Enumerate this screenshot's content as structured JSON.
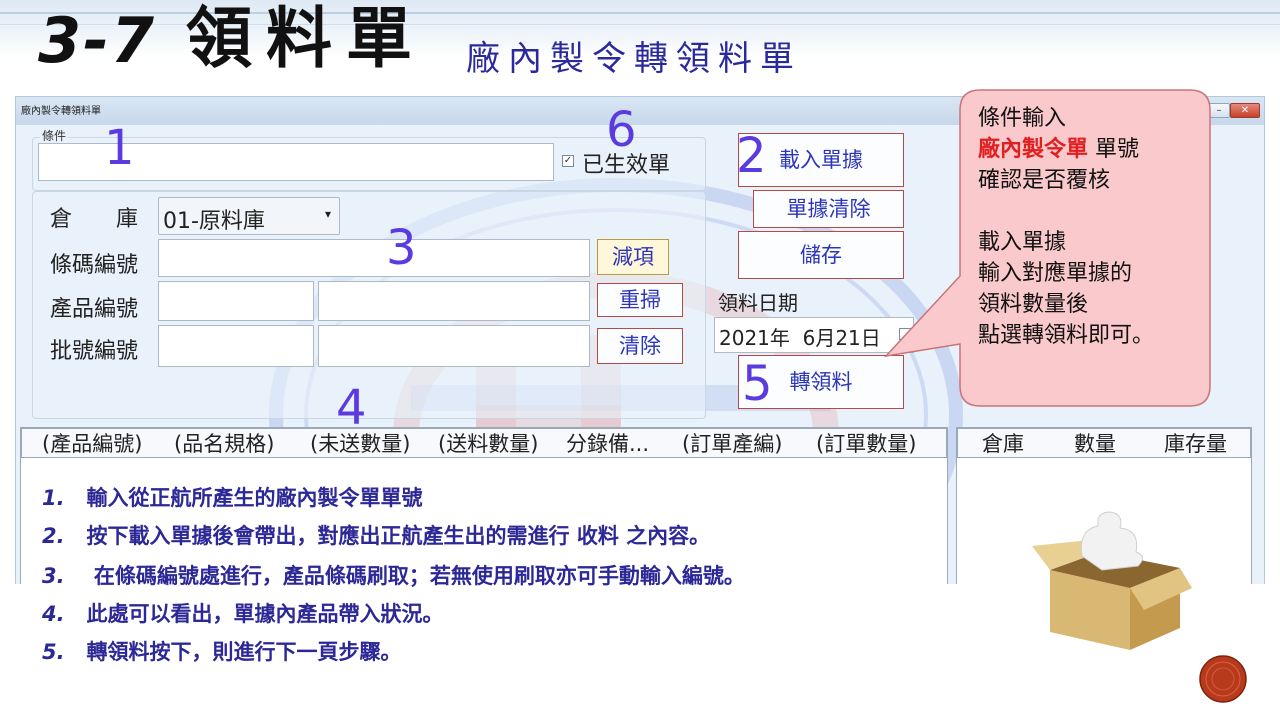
{
  "slide": {
    "number": "3-7",
    "title": "領料單",
    "subtitle": "廠內製令轉領料單"
  },
  "window": {
    "title": "廠內製令轉領料單",
    "controls": {
      "minimize": "–",
      "restore": "□",
      "close": "✕"
    }
  },
  "form": {
    "condition_label": "條件",
    "condition_value": "",
    "effective_checkbox": {
      "label": "已生效單",
      "checked": true
    },
    "warehouse_label": "倉　　庫",
    "warehouse_value": "01-原料庫",
    "barcode_label": "條碼編號",
    "barcode_value": "",
    "product_label": "產品編號",
    "product_value": "",
    "product_name_value": "",
    "batch_label": "批號編號",
    "batch_value": "",
    "batch_extra_value": "",
    "subtract_button": "減項",
    "rescan_button": "重掃",
    "clear_button": "清除",
    "load_button": "載入單據",
    "clear_doc_button": "單據清除",
    "save_button": "儲存",
    "date_label": "領料日期",
    "date_value": "2021年  6月21日",
    "transfer_button": "轉領料"
  },
  "markers": [
    "1",
    "2",
    "3",
    "4",
    "5",
    "6"
  ],
  "grid_main": {
    "columns": [
      "(產品編號)",
      "(品名規格)",
      "(未送數量)",
      "(送料數量)",
      "分錄備...",
      "(訂單產編)",
      "(訂單數量)"
    ],
    "rows": []
  },
  "grid_side": {
    "columns": [
      "倉庫",
      "數量",
      "庫存量"
    ],
    "rows": []
  },
  "callout": {
    "line1": "條件輸入",
    "line2_highlight": "廠內製令單",
    "line2_rest": "單號",
    "line3": "確認是否覆核",
    "line4": "載入單據",
    "line5": "輸入對應單據的",
    "line6": "領料數量後",
    "line7": "點選轉領料即可。"
  },
  "instructions": [
    {
      "num": "1.",
      "text": "輸入從正航所產生的廠內製令單單號"
    },
    {
      "num": "2.",
      "text": "按下載入單據後會帶出，對應出正航產生出的需進行 收料 之內容。"
    },
    {
      "num": "3.",
      "text": "在條碼編號處進行，產品條碼刷取；若無使用刷取亦可手動輸入編號。"
    },
    {
      "num": "4.",
      "text": "此處可以看出，單據內產品帶入狀況。"
    },
    {
      "num": "5.",
      "text": "轉領料按下，則進行下一頁步驟。"
    }
  ],
  "colors": {
    "title_blue": "#2a2a9c",
    "marker_purple": "#5b3be0",
    "button_text": "#2d35b8",
    "callout_fill": "#f9c9cc",
    "highlight_red": "#e02020",
    "instruction_blue": "#2c2896"
  },
  "icons": {
    "puzzle_box": "puzzle-box-icon",
    "nav_circle": "nav-circle-icon",
    "checkbox": "checkbox-icon",
    "dropdown": "chevron-down-icon",
    "calendar": "calendar-icon"
  }
}
